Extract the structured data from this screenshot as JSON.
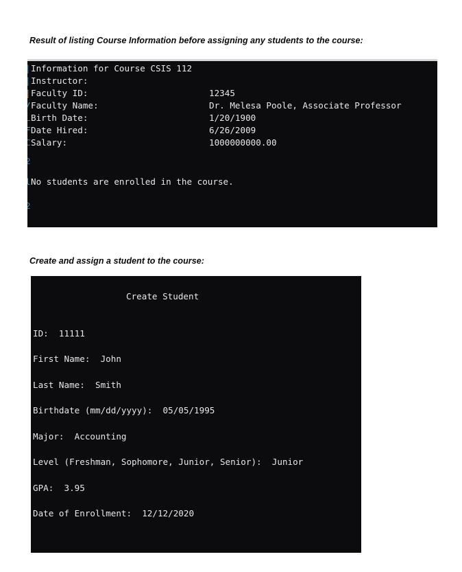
{
  "captions": {
    "course_listing": "Result of listing Course Information before assigning any students to the course:",
    "create_student": "Create and assign a student to the course:"
  },
  "colors": {
    "page_background": "#ffffff",
    "console_background": "#0c0c0e",
    "console_text": "#e8e8e8",
    "caption_text": "#0a0a0a",
    "gutter_artifact": "#2f7fa8"
  },
  "console_course": {
    "header": "Information for Course CSIS 112",
    "section_label": "Instructor:",
    "fields": [
      {
        "label": "Faculty ID:",
        "value": "12345"
      },
      {
        "label": "Faculty Name:",
        "value": "Dr. Melesa Poole, Associate Professor"
      },
      {
        "label": "Birth Date:",
        "value": "1/20/1900"
      },
      {
        "label": "Date Hired:",
        "value": "6/26/2009"
      },
      {
        "label": "Salary:",
        "value": "1000000000.00"
      }
    ],
    "enrollment_message": "No students are enrolled in the course."
  },
  "console_student": {
    "title": "Create Student",
    "fields": [
      {
        "label": "ID:",
        "value": "11111",
        "line": "ID:  11111"
      },
      {
        "label": "First Name:",
        "value": "John",
        "line": "First Name:  John"
      },
      {
        "label": "Last Name:",
        "value": "Smith",
        "line": "Last Name:  Smith"
      },
      {
        "label": "Birthdate (mm/dd/yyyy):",
        "value": "05/05/1995",
        "line": "Birthdate (mm/dd/yyyy):  05/05/1995"
      },
      {
        "label": "Major:",
        "value": "Accounting",
        "line": "Major:  Accounting"
      },
      {
        "label": "Level (Freshman, Sophomore, Junior, Senior):",
        "value": "Junior",
        "line": "Level (Freshman, Sophomore, Junior, Senior):  Junior"
      },
      {
        "label": "GPA:",
        "value": "3.95",
        "line": "GPA:  3.95"
      },
      {
        "label": "Date of Enrollment:",
        "value": "12/12/2020",
        "line": "Date of Enrollment:  12/12/2020"
      }
    ]
  },
  "gutter_fragments": {
    "course": [
      "I",
      "I",
      "F",
      "F",
      "B",
      "D",
      "S",
      "N"
    ],
    "student": []
  }
}
